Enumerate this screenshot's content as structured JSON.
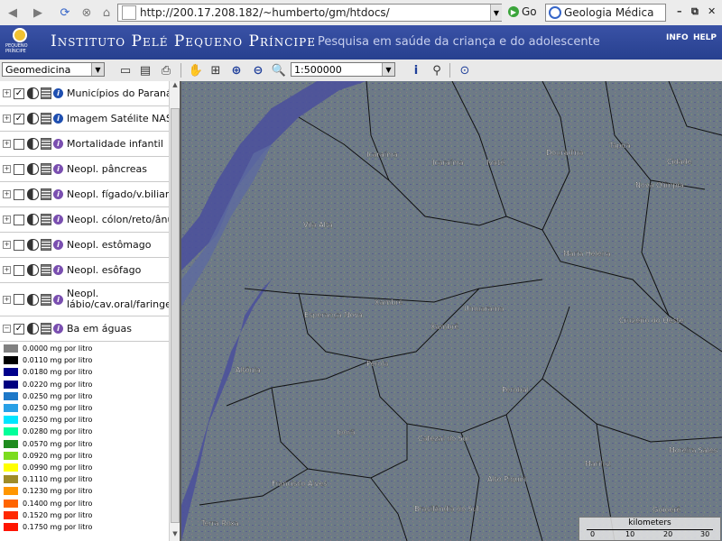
{
  "browser": {
    "url": "http://200.17.208.182/~humberto/gm/htdocs/",
    "go_label": "Go",
    "search_value": "Geologia Médica"
  },
  "app": {
    "title": "Instituto Pelé Pequeno Príncipe",
    "subtitle": "Pesquisa em saúde da criança e do adolescente",
    "info_label": "INFO",
    "help_label": "HELP"
  },
  "toolbar": {
    "map_select": "Geomedicina",
    "scale_select": "1:500000"
  },
  "layers": [
    {
      "label": "Municípios do Paraná",
      "checked": true
    },
    {
      "label": "Imagem Satélite NASA",
      "checked": true
    },
    {
      "label": "Mortalidade infantil",
      "checked": false
    },
    {
      "label": "Neopl. pâncreas",
      "checked": false
    },
    {
      "label": "Neopl. fígado/v.biliares",
      "checked": false
    },
    {
      "label": "Neopl. cólon/reto/ânus",
      "checked": false
    },
    {
      "label": "Neopl. estômago",
      "checked": false
    },
    {
      "label": "Neopl. esôfago",
      "checked": false
    },
    {
      "label": "Neopl. lábio/cav.oral/faringe",
      "checked": false
    },
    {
      "label": "Ba em águas",
      "checked": true
    }
  ],
  "legend": [
    {
      "label": "0.0000 mg por litro",
      "color": "#808080"
    },
    {
      "label": "0.0110 mg por litro",
      "color": "#000000"
    },
    {
      "label": "0.0180 mg por litro",
      "color": "#00008b"
    },
    {
      "label": "0.0220 mg por litro",
      "color": "#000080"
    },
    {
      "label": "0.0250 mg por litro",
      "color": "#1e78c8"
    },
    {
      "label": "0.0250 mg por litro",
      "color": "#28a0e6"
    },
    {
      "label": "0.0250 mg por litro",
      "color": "#00e6ff"
    },
    {
      "label": "0.0280 mg por litro",
      "color": "#00ff9a"
    },
    {
      "label": "0.0570 mg por litro",
      "color": "#1e8c1e"
    },
    {
      "label": "0.0920 mg por litro",
      "color": "#7cdc1e"
    },
    {
      "label": "0.0990 mg por litro",
      "color": "#ffff00"
    },
    {
      "label": "0.1110 mg por litro",
      "color": "#a08c28"
    },
    {
      "label": "0.1230 mg por litro",
      "color": "#ff9600"
    },
    {
      "label": "0.1400 mg por litro",
      "color": "#ff6400"
    },
    {
      "label": "0.1520 mg por litro",
      "color": "#ff2800"
    },
    {
      "label": "0.1750 mg por litro",
      "color": "#ff1400"
    }
  ],
  "map": {
    "cities": [
      "Icaraíma",
      "Icaraíma",
      "Ivaté",
      "Douradina",
      "Tapira",
      "Cidade",
      "Nova Olímpia",
      "Vila Alta",
      "Maria Helena",
      "Xambrê",
      "Xambrê",
      "Esperança Nova",
      "Umuarama",
      "Cruzeiro do Oeste",
      "Pérola",
      "Altônia",
      "Perobal",
      "Iporã",
      "Cafezal do Sul",
      "Moreira Sales",
      "Francisco Alves",
      "Alto Piquiri",
      "Mariluz",
      "Brasilândia do Sul",
      "Goioerê",
      "Terra Roxa"
    ]
  },
  "scale": {
    "unit_label": "kilometers",
    "ticks": [
      "0",
      "10",
      "20",
      "30"
    ]
  },
  "colors": {
    "header": "#2f4899",
    "map_land": "#6d7a86",
    "river": "#4a4f9c"
  }
}
